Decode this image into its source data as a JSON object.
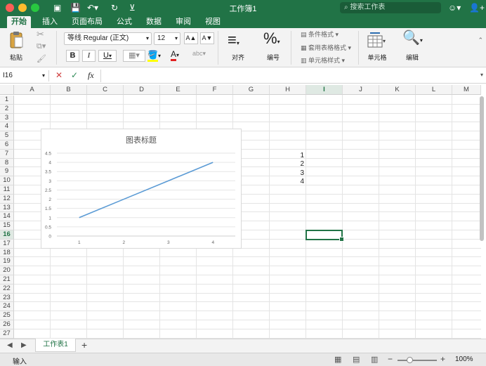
{
  "window": {
    "title": "工作簿1",
    "search_placeholder": "搜索工作表"
  },
  "ribbon_tabs": [
    "开始",
    "插入",
    "页面布局",
    "公式",
    "数据",
    "审阅",
    "视图"
  ],
  "ribbon": {
    "paste_label": "粘贴",
    "font_name": "等线 Regular (正文)",
    "font_size": "12",
    "grow_font": "A▲",
    "shrink_font": "A▼",
    "bold": "B",
    "italic": "I",
    "underline": "U",
    "align_label": "对齐",
    "number_label": "编号",
    "conditional_format": "条件格式",
    "format_as_table": "套用表格格式",
    "cell_styles": "单元格样式",
    "cells_label": "单元格",
    "edit_label": "编辑"
  },
  "formula_bar": {
    "name_box": "I16",
    "cancel": "✕",
    "enter": "✓",
    "fx": "fx",
    "value": ""
  },
  "columns": [
    "A",
    "B",
    "C",
    "D",
    "E",
    "F",
    "G",
    "H",
    "I",
    "J",
    "K",
    "L",
    "M"
  ],
  "rows": [
    "1",
    "2",
    "3",
    "4",
    "5",
    "6",
    "7",
    "8",
    "9",
    "10",
    "11",
    "12",
    "13",
    "14",
    "15",
    "16",
    "17",
    "18",
    "19",
    "20",
    "21",
    "22",
    "23",
    "24",
    "25",
    "26",
    "27"
  ],
  "cells": {
    "H7": "1",
    "H8": "2",
    "H9": "3",
    "H10": "4"
  },
  "chart_data": {
    "type": "line",
    "title": "图表标题",
    "categories": [
      "1",
      "2",
      "3",
      "4"
    ],
    "series": [
      {
        "values": [
          1,
          2,
          3,
          4
        ]
      }
    ],
    "ylim": [
      0,
      4.5
    ],
    "yticks": [
      "0",
      "0.5",
      "1",
      "1.5",
      "2",
      "2.5",
      "3",
      "3.5",
      "4",
      "4.5"
    ],
    "grid": true,
    "color": "#5b9bd5"
  },
  "sheet_tabs": [
    "工作表1"
  ],
  "status": {
    "mode": "输入",
    "zoom": "100%"
  }
}
